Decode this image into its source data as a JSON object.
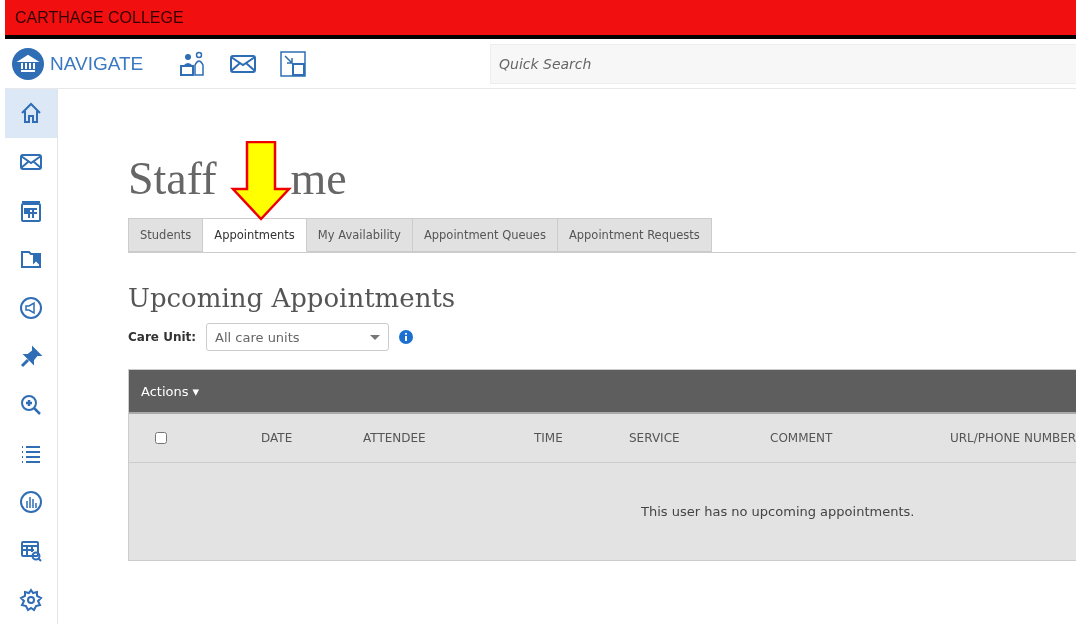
{
  "top_bar": {
    "title": "CARTHAGE COLLEGE"
  },
  "header": {
    "brand": "NAVIGATE",
    "search": {
      "placeholder": "Quick Search"
    }
  },
  "sidebar": {
    "items": [
      {
        "kind": "home",
        "selected": true
      },
      {
        "kind": "mail",
        "selected": false
      },
      {
        "kind": "calendar",
        "selected": false
      },
      {
        "kind": "folder",
        "selected": false
      },
      {
        "kind": "megaphone",
        "selected": false
      },
      {
        "kind": "pin",
        "selected": false
      },
      {
        "kind": "zoom",
        "selected": false
      },
      {
        "kind": "list",
        "selected": false
      },
      {
        "kind": "chart",
        "selected": false
      },
      {
        "kind": "report",
        "selected": false
      },
      {
        "kind": "gear",
        "selected": false
      }
    ]
  },
  "page_title": [
    "Staff",
    "me"
  ],
  "tabs": [
    {
      "label": "Students",
      "selected": false
    },
    {
      "label": "Appointments",
      "selected": true
    },
    {
      "label": "My Availability",
      "selected": false
    },
    {
      "label": "Appointment Queues",
      "selected": false
    },
    {
      "label": "Appointment Requests",
      "selected": false
    }
  ],
  "section_title": "Upcoming Appointments",
  "care_unit": {
    "label": "Care Unit:",
    "value": "All care units"
  },
  "table": {
    "actions": "Actions ▾",
    "select_all": {
      "checked": false
    },
    "columns": [
      "DATE",
      "ATTENDEE",
      "TIME",
      "SERVICE",
      "COMMENT",
      "URL/PHONE NUMBER"
    ],
    "empty_message": "This user has no upcoming appointments."
  },
  "annotation": {
    "kind": "arrow"
  }
}
